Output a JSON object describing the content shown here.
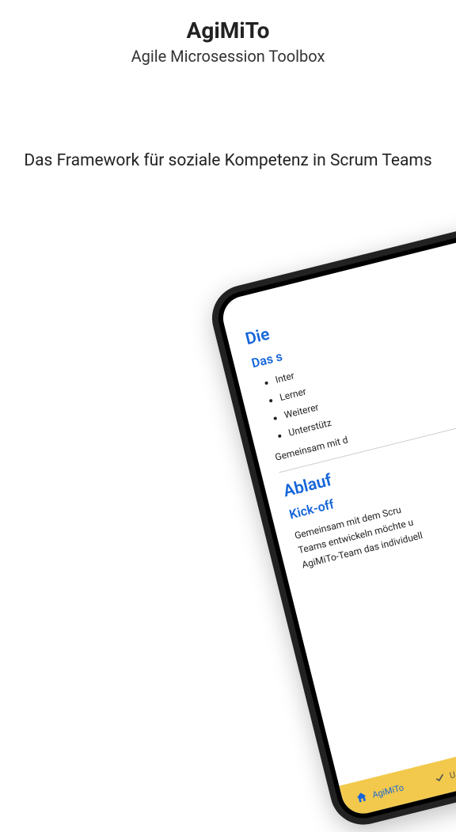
{
  "header": {
    "title": "AgiMiTo",
    "subtitle": "Agile Microsession Toolbox"
  },
  "tagline": "Das Framework für soziale Kompetenz in Scrum Teams",
  "device": {
    "section1": {
      "title": "Die",
      "subtitle": "Das s",
      "bullets": [
        "Inter",
        "Lerner",
        "Weiterer",
        "Unterstütz"
      ],
      "paragraph": "Gemeinsam mit d"
    },
    "section2": {
      "title": "Ablauf",
      "subtitle": "Kick-off",
      "paragraph1": "Gemeinsam mit dem Scru",
      "paragraph2": "Teams entwickeln möchte u",
      "paragraph3": "AgiMiTo-Team das individuell"
    },
    "nav": {
      "home_label": "AgiMiTo",
      "second_label": "U"
    }
  }
}
